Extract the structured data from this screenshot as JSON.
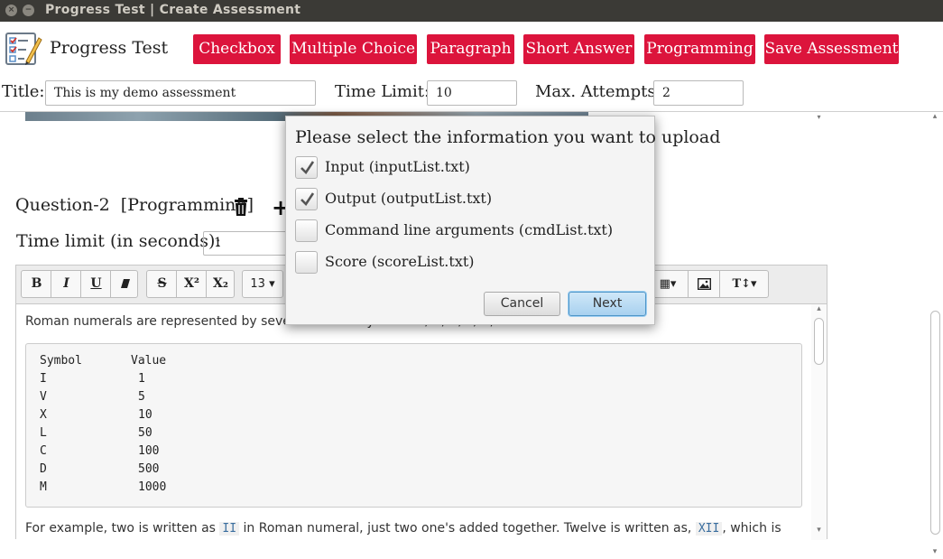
{
  "window": {
    "title": "Progress Test | Create Assessment",
    "close_glyph": "×",
    "minimize_glyph": "−"
  },
  "header": {
    "app_name": "Progress Test",
    "logo_icon": "checklist-pencil-icon",
    "buttons": [
      "Checkbox",
      "Multiple Choice",
      "Paragraph",
      "Short Answer",
      "Programming",
      "Save Assessment"
    ],
    "button_color": "#dc143c"
  },
  "form": {
    "title_label": "Title:",
    "title_value": "This is my demo assessment",
    "time_limit_label": "Time Limit:",
    "time_limit_value": "10",
    "attempts_label": "Max. Attempts:",
    "attempts_value": "2"
  },
  "question": {
    "heading": "Question-2  [Programming]",
    "delete_icon": "trash-icon",
    "add_icon": "plus-icon",
    "time_limit_label": "Time limit (in seconds):",
    "time_limit_value": "1"
  },
  "editor": {
    "toolbar": {
      "bold": "B",
      "italic": "I",
      "underline": "U",
      "strike": "S",
      "superscript": "X²",
      "subscript": "X₂",
      "font_size": "13 ▾",
      "table": "▦▾",
      "image": "image-icon",
      "text_size": "T↕▾"
    },
    "paragraph_1": "Roman numerals are represented by seven different symbols: I, V, X, L, C, D and M.",
    "code_header": [
      "Symbol",
      "Value"
    ],
    "code_rows": [
      [
        "I",
        "1"
      ],
      [
        "V",
        "5"
      ],
      [
        "X",
        "10"
      ],
      [
        "L",
        "50"
      ],
      [
        "C",
        "100"
      ],
      [
        "D",
        "500"
      ],
      [
        "M",
        "1000"
      ]
    ],
    "paragraph_2": {
      "part_a": "For example, two is written as ",
      "code_a": "II",
      "part_b": " in Roman numeral, just two one's added together. Twelve is written as, ",
      "code_b": "XII",
      "part_c": ", which is"
    }
  },
  "dialog": {
    "title": "Please select the information you want to upload",
    "options": [
      {
        "label": "Input (inputList.txt)",
        "checked": true
      },
      {
        "label": "Output (outputList.txt)",
        "checked": true
      },
      {
        "label": "Command line arguments (cmdList.txt)",
        "checked": false
      },
      {
        "label": "Score (scoreList.txt)",
        "checked": false
      }
    ],
    "cancel_label": "Cancel",
    "next_label": "Next"
  }
}
